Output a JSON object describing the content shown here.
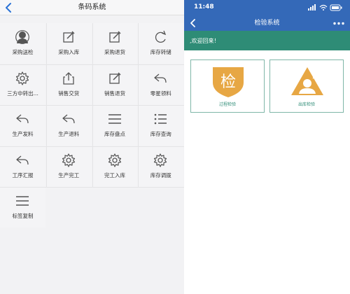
{
  "left_app": {
    "title": "条码系统",
    "tiles": [
      {
        "label": "采购送检",
        "icon": "user-icon"
      },
      {
        "label": "采购入库",
        "icon": "edit-icon"
      },
      {
        "label": "采购退货",
        "icon": "edit-icon"
      },
      {
        "label": "库存转储",
        "icon": "refresh-icon"
      },
      {
        "label": "三方中转出...",
        "icon": "gear-icon"
      },
      {
        "label": "销售交货",
        "icon": "share-icon"
      },
      {
        "label": "销售退货",
        "icon": "edit-icon"
      },
      {
        "label": "零星领料",
        "icon": "reply-icon"
      },
      {
        "label": "生产发料",
        "icon": "reply-icon"
      },
      {
        "label": "生产退料",
        "icon": "reply-icon"
      },
      {
        "label": "库存盘点",
        "icon": "menu-icon"
      },
      {
        "label": "库存查询",
        "icon": "list-icon"
      },
      {
        "label": "工序汇报",
        "icon": "reply-icon"
      },
      {
        "label": "生产完工",
        "icon": "gear-icon"
      },
      {
        "label": "完工入库",
        "icon": "gear-icon"
      },
      {
        "label": "库存调拨",
        "icon": "gear-icon"
      },
      {
        "label": "标签复制",
        "icon": "menu-icon"
      }
    ]
  },
  "right_app": {
    "status_time": "11:48",
    "title": "检验系统",
    "welcome": ",欢迎回来！",
    "cards": [
      {
        "label": "过程检验",
        "icon": "inspect-shield-icon",
        "glyph": "检",
        "color": "#e7a744"
      },
      {
        "label": "出库检验",
        "icon": "warning-person-icon",
        "color": "#e7a744"
      }
    ]
  }
}
